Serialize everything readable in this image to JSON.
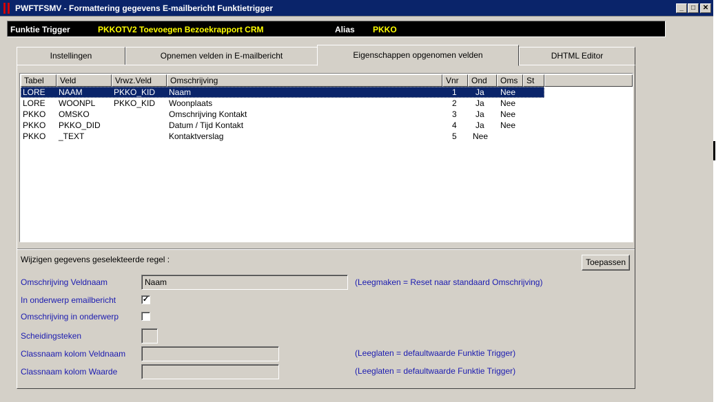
{
  "window": {
    "title": "PWFTFSMV - Formattering gegevens E-mailbericht Funktietrigger",
    "buttons": {
      "minimize": "_",
      "maximize": "□",
      "close": "✕"
    }
  },
  "infobar": {
    "label": "Funktie Trigger",
    "value": "PKKOTV2  Toevoegen Bezoekrapport CRM",
    "alias_label": "Alias",
    "alias_value": "PKKO"
  },
  "tabs": [
    {
      "label": "Instellingen"
    },
    {
      "label": "Opnemen velden in E-mailbericht"
    },
    {
      "label": "Eigenschappen opgenomen velden",
      "active": true
    },
    {
      "label": "DHTML Editor"
    }
  ],
  "grid": {
    "columns": [
      "Tabel",
      "Veld",
      "Vrwz.Veld",
      "Omschrijving",
      "Vnr",
      "Ond",
      "Oms",
      "St"
    ],
    "rows": [
      {
        "tabel": "LORE",
        "veld": "NAAM",
        "vrwz": "PKKO_KID",
        "omschrijving": "Naam",
        "vnr": "1",
        "ond": "Ja",
        "oms": "Nee",
        "st": "",
        "selected": true
      },
      {
        "tabel": "LORE",
        "veld": "WOONPL",
        "vrwz": "PKKO_KID",
        "omschrijving": "Woonplaats",
        "vnr": "2",
        "ond": "Ja",
        "oms": "Nee",
        "st": ""
      },
      {
        "tabel": "PKKO",
        "veld": "OMSKO",
        "vrwz": "",
        "omschrijving": "Omschrijving Kontakt",
        "vnr": "3",
        "ond": "Ja",
        "oms": "Nee",
        "st": ""
      },
      {
        "tabel": "PKKO",
        "veld": "PKKO_DID",
        "vrwz": "",
        "omschrijving": "Datum / Tijd Kontakt",
        "vnr": "4",
        "ond": "Ja",
        "oms": "Nee",
        "st": ""
      },
      {
        "tabel": "PKKO",
        "veld": "_TEXT",
        "vrwz": "",
        "omschrijving": "Kontaktverslag",
        "vnr": "5",
        "ond": "Nee",
        "oms": "",
        "st": ""
      }
    ]
  },
  "edit": {
    "heading": "Wijzigen gegevens geselekteerde regel :",
    "apply_button": "Toepassen",
    "omschrijving_label": "Omschrijving Veldnaam",
    "omschrijving_value": "Naam",
    "omschrijving_hint": "(Leegmaken = Reset naar standaard Omschrijving)",
    "onderwerp_label": "In onderwerp emailbericht",
    "onderwerp_checked": true,
    "oms_onderwerp_label": "Omschrijving in onderwerp",
    "oms_onderwerp_checked": false,
    "scheiding_label": "Scheidingsteken",
    "scheiding_value": "",
    "class_veld_label": "Classnaam kolom Veldnaam",
    "class_veld_value": "",
    "class_veld_hint": "(Leeglaten = defaultwaarde Funktie Trigger)",
    "class_waarde_label": "Classnaam kolom Waarde",
    "class_waarde_value": "",
    "class_waarde_hint": "(Leeglaten = defaultwaarde Funktie Trigger)"
  },
  "colors": {
    "titlebar": "#0a246a",
    "info_label": "#ffffff",
    "info_value": "#ffff00",
    "selection": "#0a246a",
    "label_blue": "#1a1ab0",
    "window": "#d4d0c8"
  }
}
